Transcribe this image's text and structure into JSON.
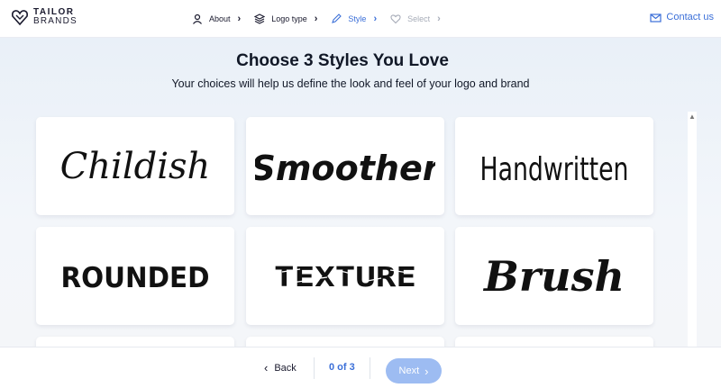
{
  "header": {
    "logo": {
      "line1": "TAILOR",
      "line2": "BRANDS"
    },
    "steps": [
      {
        "label": "About",
        "icon": "user-icon",
        "state": "done"
      },
      {
        "label": "Logo type",
        "icon": "layers-icon",
        "state": "done"
      },
      {
        "label": "Style",
        "icon": "pencil-icon",
        "state": "active"
      },
      {
        "label": "Select",
        "icon": "heart-icon",
        "state": "disabled"
      }
    ],
    "contact_label": "Contact us"
  },
  "main": {
    "title": "Choose 3 Styles You Love",
    "subtitle": "Your choices will help us define the look and feel of your logo and brand",
    "styles": [
      {
        "name": "Childish"
      },
      {
        "name": "Smoother"
      },
      {
        "name": "Handwritten"
      },
      {
        "name": "ROUNDED"
      },
      {
        "name": "TEXTURE"
      },
      {
        "name": "Brush"
      }
    ]
  },
  "footer": {
    "back_label": "Back",
    "counter": "0 of 3",
    "next_label": "Next"
  },
  "colors": {
    "accent": "#3b6fd8",
    "next_button": "#9dbcf2",
    "bg_top": "#e9f0f8"
  }
}
